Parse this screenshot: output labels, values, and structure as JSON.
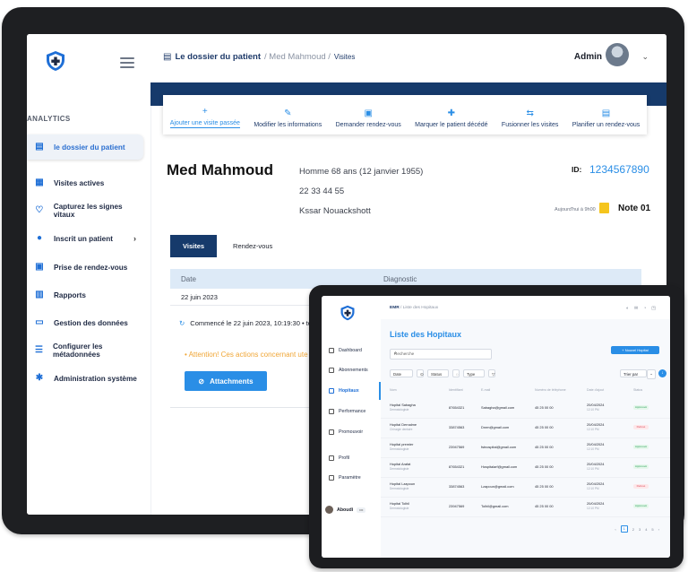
{
  "desktop": {
    "sidebar": {
      "section_label": "ANALYTICS",
      "items": [
        {
          "label": "le dossier du patient",
          "icon": "folder-icon",
          "active": true
        },
        {
          "label": "Visites actives",
          "icon": "calendar-icon"
        },
        {
          "label": "Capturez les signes vitaux",
          "icon": "heartbeat-icon"
        },
        {
          "label": "Inscrit un patient",
          "icon": "user-icon",
          "chevron": "›"
        },
        {
          "label": "Prise de rendez-vous",
          "icon": "calendar-plus-icon"
        },
        {
          "label": "Rapports",
          "icon": "report-icon"
        },
        {
          "label": "Gestion des données",
          "icon": "database-icon"
        },
        {
          "label": "Configurer les métadonnées",
          "icon": "list-icon"
        },
        {
          "label": "Administration système",
          "icon": "gear-icon"
        }
      ]
    },
    "header": {
      "breadcrumb_main": "Le dossier du patient",
      "breadcrumb_sep": "/ Med Mahmoud /",
      "breadcrumb_current": "Visites",
      "user_name": "Admin",
      "caret": "⌄"
    },
    "toolbar": [
      {
        "label": "Ajouter une visite passée",
        "glyph": "+"
      },
      {
        "label": "Modifier les informations",
        "glyph": "✎"
      },
      {
        "label": "Demander rendez-vous",
        "glyph": "▣"
      },
      {
        "label": "Marquer le patient décédé",
        "glyph": "✚"
      },
      {
        "label": "Fusionner les visites",
        "glyph": "⇆"
      },
      {
        "label": "Planifier un rendez-vous",
        "glyph": "▤"
      }
    ],
    "patient": {
      "name": "Med Mahmoud",
      "gender_age": "Homme 68 ans (12 janvier 1955)",
      "phone": "22 33 44 55",
      "address": "Kssar Nouackshott",
      "id_label": "ID:",
      "id_value": "1234567890",
      "today_label": "Aujourd'hui à 9h00",
      "note_label": "Note 01"
    },
    "tabs": {
      "active": "Visites",
      "other": "Rendez-vous"
    },
    "table": {
      "headers": [
        "Date",
        "Diagnostic"
      ],
      "row_date": "22 juin 2023"
    },
    "schedule_text": "Commencé le 22 juin 2023, 10:19:30  •  terr",
    "warning_text": "•  Attention! Ces actions concernant ute",
    "attach_label": "Attachments"
  },
  "tablet": {
    "sidebar": {
      "items": [
        {
          "label": "Dashboard"
        },
        {
          "label": "Abonnements"
        },
        {
          "label": "Hopitaux",
          "active": true
        },
        {
          "label": "Performance"
        },
        {
          "label": "Promouvoir"
        },
        {
          "label": "Profil"
        },
        {
          "label": "Paramètre"
        }
      ],
      "user": "Aboudi",
      "user_more": "•••"
    },
    "breadcrumb_main": "EMR",
    "breadcrumb_rest": "/ Liste des Hopitaux",
    "title": "Liste des Hopitaux",
    "search_placeholder": "Recherche",
    "new_button": "+ Nouvel Hopital",
    "filters": [
      "Date",
      "Status",
      "Type"
    ],
    "sort_label": "Trier par",
    "columns": [
      "Nom",
      "Identifiant",
      "E-mail",
      "Numéro de téléphone",
      "Date d'ajout",
      "Status"
    ],
    "rows": [
      {
        "name": "Hopital Sabagha",
        "sub": "Dermatologiste",
        "id": "87654321",
        "email": "Sabagha@gmail.com",
        "phone": "45 25 00 00",
        "date": "20/04/2024",
        "time": "12:10 PM",
        "status": "Approuvé",
        "ok": true
      },
      {
        "name": "Hopital Dernalme",
        "sub": "Chirurgie dentaire",
        "id": "33874563",
        "email": "Dnrm@gmail.com",
        "phone": "45 25 00 00",
        "date": "20/04/2024",
        "time": "12:10 PM",
        "status": "Refusé",
        "ok": false
      },
      {
        "name": "Hopital premier",
        "sub": "Dermatologiste",
        "id": "23947569",
        "email": "fstnospital@gmail.com",
        "phone": "45 25 00 00",
        "date": "20/04/2024",
        "time": "12:10 PM",
        "status": "Approuvé",
        "ok": true
      },
      {
        "name": "Hopital Arafat",
        "sub": "Dermatologiste",
        "id": "87654321",
        "email": "Hospitalarf@gmail.com",
        "phone": "45 25 00 00",
        "date": "20/04/2024",
        "time": "12:10 PM",
        "status": "Approuvé",
        "ok": true
      },
      {
        "name": "Hopital Lzapoun",
        "sub": "Dermatologiste",
        "id": "33874563",
        "email": "Lzapoun@gmail.com",
        "phone": "45 25 00 00",
        "date": "20/04/2024",
        "time": "12:10 PM",
        "status": "Refusé",
        "ok": false
      },
      {
        "name": "Hopital Tolhil",
        "sub": "Dermatologiste",
        "id": "23947569",
        "email": "Tolhil@gmail.com",
        "phone": "45 25 00 00",
        "date": "20/04/2024",
        "time": "12:10 PM",
        "status": "Approuvé",
        "ok": true
      }
    ],
    "pagination": [
      "‹",
      "1",
      "2",
      "3",
      "4",
      "5",
      "›"
    ],
    "active_page": "1"
  },
  "colors": {
    "accent": "#2a8ee6",
    "navy": "#163a6b",
    "note": "#f5c51d"
  }
}
